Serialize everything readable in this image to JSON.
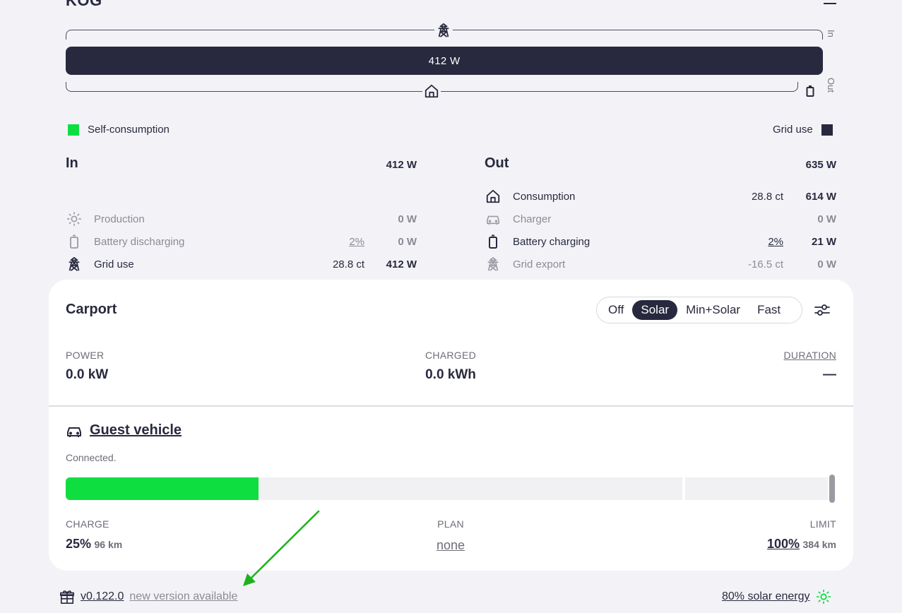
{
  "header": {
    "site_title": "KOG",
    "menu_icon": "hamburger-icon"
  },
  "energyflow": {
    "bar_value": "412 W",
    "in_label": "In",
    "out_label": "Out",
    "self_consumption_label": "Self-consumption",
    "grid_use_label": "Grid use",
    "colors": {
      "self_consumption": "#0fde41",
      "grid_use": "#28293e"
    }
  },
  "in_column": {
    "title": "In",
    "total": "412 W",
    "rows": [
      {
        "icon": "sun-icon",
        "label": "Production",
        "price": "",
        "value": "0 W"
      },
      {
        "icon": "battery-icon",
        "label": "Battery discharging",
        "price": "2%",
        "value": "0 W"
      },
      {
        "icon": "tower-icon",
        "label": "Grid use",
        "price": "28.8 ct",
        "value": "412 W"
      }
    ]
  },
  "out_column": {
    "title": "Out",
    "total": "635 W",
    "rows": [
      {
        "icon": "home-icon",
        "label": "Consumption",
        "price": "28.8 ct",
        "value": "614 W"
      },
      {
        "icon": "car-icon",
        "label": "Charger",
        "price": "",
        "value": "0 W"
      },
      {
        "icon": "battery-icon",
        "label": "Battery charging",
        "price": "2%",
        "value": "21 W"
      },
      {
        "icon": "tower-icon",
        "label": "Grid export",
        "price": "-16.5 ct",
        "value": "0 W"
      }
    ]
  },
  "loadpoint": {
    "title": "Carport",
    "modes": [
      "Off",
      "Solar",
      "Min+Solar",
      "Fast"
    ],
    "active_mode": "Solar",
    "power_label": "POWER",
    "power_value": "0.0 kW",
    "charged_label": "CHARGED",
    "charged_value": "0.0 kWh",
    "duration_label": "DURATION",
    "duration_value": "—"
  },
  "vehicle": {
    "name": "Guest vehicle",
    "status": "Connected.",
    "soc_fraction": 0.25,
    "limit_fraction": 1.0,
    "charge_label": "CHARGE",
    "charge_pct": "25%",
    "charge_km": "96 km",
    "plan_label": "PLAN",
    "plan_value": "none",
    "limit_label": "LIMIT",
    "limit_pct": "100%",
    "limit_km": "384 km"
  },
  "footer": {
    "version": "v0.122.0",
    "update_text": "new version available",
    "solar_text": "80% solar energy"
  }
}
